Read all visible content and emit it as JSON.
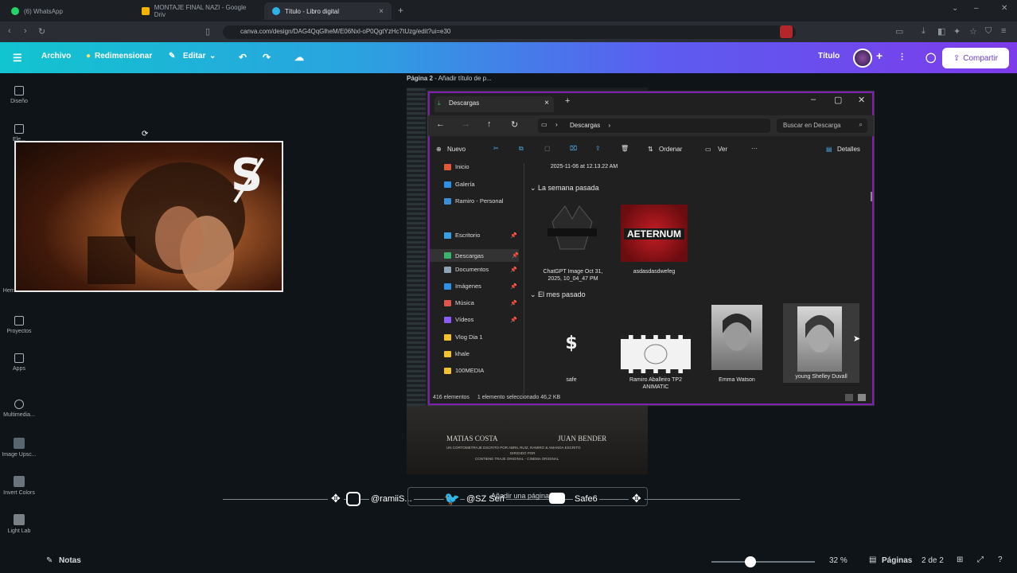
{
  "browser": {
    "tabs": [
      {
        "label": "(6) WhatsApp",
        "color": "#25d366"
      },
      {
        "label": "MONTAJE FINAL NAZI - Google Driv",
        "color": "#f4b400"
      },
      {
        "label": "Título - Libro digital",
        "color": "#2bb3e6",
        "close": "×"
      }
    ],
    "new_tab": "+",
    "url": "canva.com/design/DAG4QqGlheM/E06Nxl-oP0QgtYzHc7tUzg/edit?ui=e30"
  },
  "canva_header": {
    "file": "Archivo",
    "resize": "Redimensionar",
    "edit": "Editar",
    "title": "Título",
    "share": "Compartir",
    "colors": {
      "share_text": "#6a3ec8"
    }
  },
  "rail": [
    {
      "label": "Diseño"
    },
    {
      "label": "Ele..."
    },
    {
      "label": "Herramient..."
    },
    {
      "label": "Proyectos"
    },
    {
      "label": "Apps"
    },
    {
      "label": "Multimedia..."
    },
    {
      "label": "Image Upsc..."
    },
    {
      "label": "Invert Colors"
    },
    {
      "label": "Light Lab"
    }
  ],
  "page_header": {
    "label": "Página 2",
    "placeholder": "- Añadir título de p..."
  },
  "poster": {
    "name1": "MATIAS COSTA",
    "name2": "JUAN BENDER",
    "credit1": "UN CORTOMETRAJE ESCRITO POR ABRIL RUIZ, RAMIRO & AMANDA ESCRITO",
    "credit2": "DIRIGIDO POR",
    "credit3": "CONTIENE TRAJE ORIGINAL - CINEMA ORIGINAL"
  },
  "explorer": {
    "tab_title": "Descargas",
    "path": "Descargas",
    "search": "Buscar en Descarga",
    "commands": {
      "new": "Nuevo",
      "sort": "Ordenar",
      "view": "Ver",
      "more": "···",
      "details": "Detalles"
    },
    "sidebar": [
      {
        "label": "Inicio",
        "color": "#e05a3a"
      },
      {
        "label": "Galería",
        "color": "#2f8ee6"
      },
      {
        "label": "Ramiro - Personal",
        "color": "#3a8fd8"
      },
      {
        "label": "Escritorio",
        "color": "#3aa0e6",
        "pin": "📌"
      },
      {
        "label": "Descargas",
        "color": "#3bb36b",
        "pin": "📌"
      },
      {
        "label": "Documentos",
        "color": "#8fa3b8",
        "pin": "📌"
      },
      {
        "label": "Imágenes",
        "color": "#2f8ee6",
        "pin": "📌"
      },
      {
        "label": "Música",
        "color": "#e0564a",
        "pin": "📌"
      },
      {
        "label": "Vídeos",
        "color": "#8b5cf6",
        "pin": "📌"
      },
      {
        "label": "Vlog Dia 1",
        "color": "#f2c230"
      },
      {
        "label": "khale",
        "color": "#f2c230"
      },
      {
        "label": "100MEDIA",
        "color": "#f2c230"
      }
    ],
    "top_caption": "2025-11-06 at 12.13.22 AM",
    "groups": {
      "week": "La semana pasada",
      "month": "El mes pasado"
    },
    "files": [
      {
        "name": "ChatGPT Image Oct 31, 2025, 10_04_47 PM"
      },
      {
        "name": "asdasdasdwefeg",
        "logo": "AETERNUM"
      },
      {
        "name": "safe",
        "glyph": "$"
      },
      {
        "name": "Ramiro Aballeiro TP2 ANIMATIC"
      },
      {
        "name": "Emma Watson"
      },
      {
        "name": "young Shelley Duvall"
      }
    ],
    "status": {
      "count": "416 elementos",
      "selected": "1 elemento seleccionado  46,2 KB"
    }
  },
  "social": {
    "instagram": "@ramiiS...",
    "twitter": "@SZ Seri",
    "add_page": "Añadir una página",
    "youtube": "Safe6"
  },
  "bottom": {
    "notes": "Notas",
    "zoom": "32 %",
    "pages_label": "Páginas",
    "pages_value": "2 de 2",
    "zoom_fraction": 0.38
  }
}
